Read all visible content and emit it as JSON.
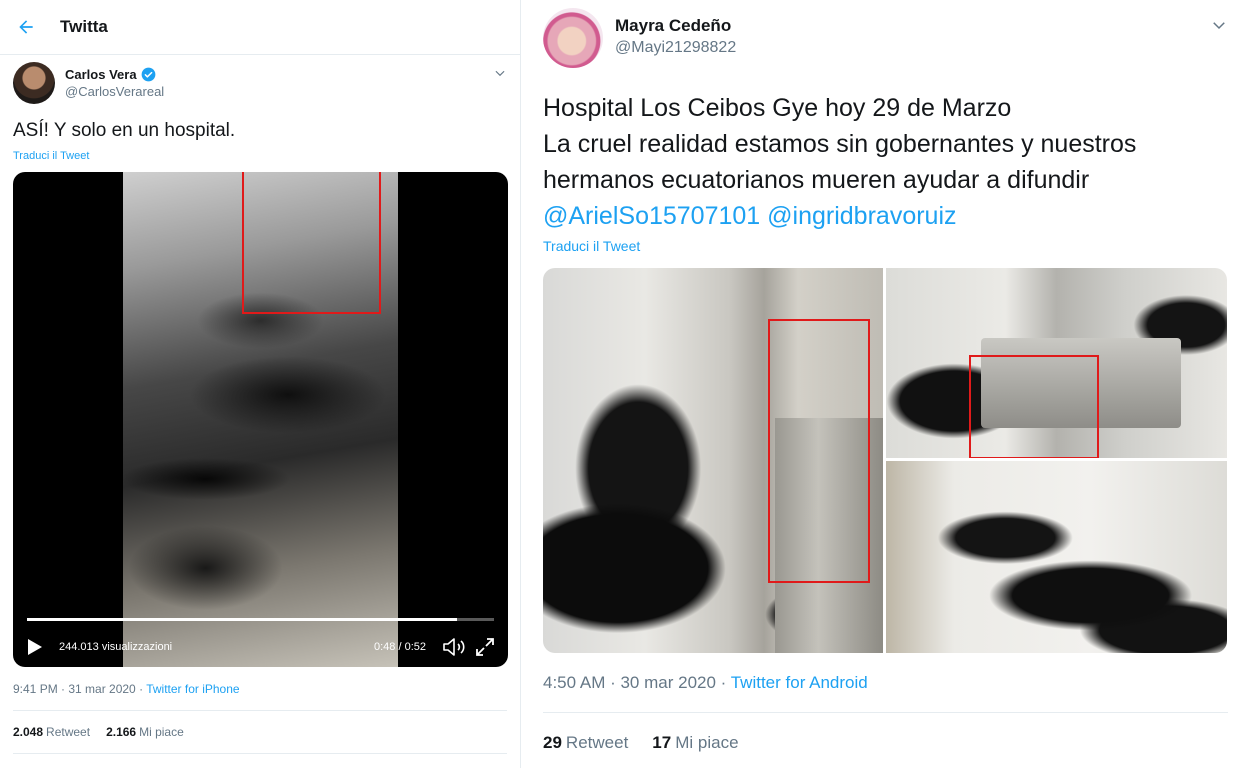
{
  "left_tweet": {
    "header_title": "Twitta",
    "author_name": "Carlos Vera",
    "author_handle": "@CarlosVerareal",
    "text": "ASÍ! Y solo en un hospital.",
    "translate_label": "Traduci il Tweet",
    "video": {
      "views": "244.013 visualizzazioni",
      "time": "0:48 / 0:52",
      "progress": 0.92
    },
    "timestamp": "9:41 PM · 31 mar 2020 · ",
    "source": "Twitter for iPhone",
    "retweets_count": "2.048",
    "retweets_label": "Retweet",
    "likes_count": "2.166",
    "likes_label": "Mi piace"
  },
  "right_tweet": {
    "author_name": "Mayra Cedeño",
    "author_handle": "@Mayi21298822",
    "text_line1": "Hospital Los Ceibos Gye hoy 29 de Marzo",
    "text_line2": "La cruel realidad estamos sin gobernantes y nuestros hermanos ecuatorianos mueren ayudar a difundir",
    "mention1": "@ArielSo15707101",
    "mention2": "@ingridbravoruiz",
    "translate_label": "Traduci il Tweet",
    "timestamp": "4:50 AM · 30 mar 2020 · ",
    "source": "Twitter for Android",
    "retweets_count": "29",
    "retweets_label": "Retweet",
    "likes_count": "17",
    "likes_label": "Mi piace"
  },
  "colors": {
    "link": "#1da1f2",
    "highlight_box": "#e01a1a",
    "muted": "#657786"
  }
}
